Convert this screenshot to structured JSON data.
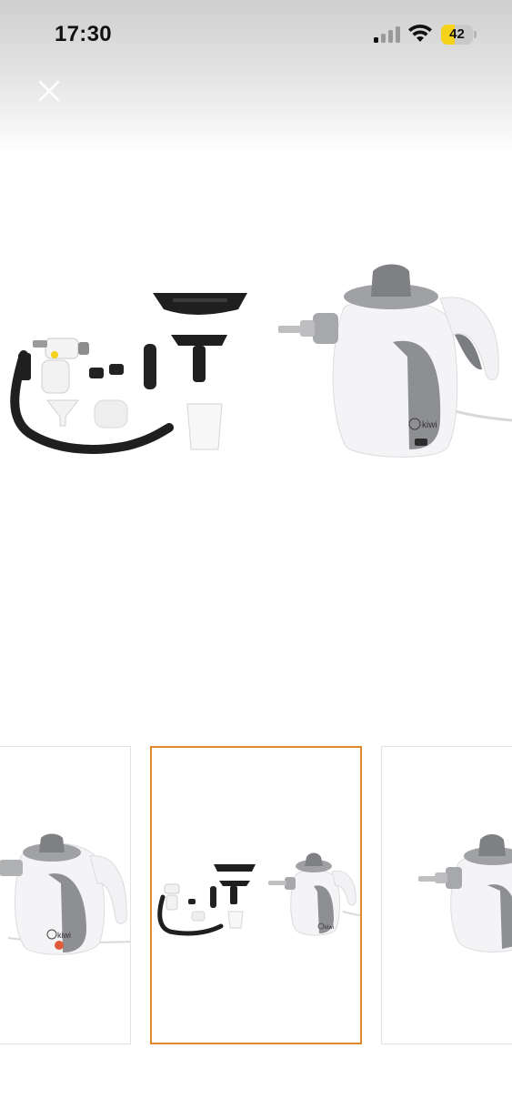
{
  "status_bar": {
    "time": "17:30",
    "battery_level": "42",
    "battery_fraction": 0.42,
    "signal_icon": "cellular-signal-icon",
    "wifi_icon": "wifi-icon"
  },
  "toolbar": {
    "close_icon": "close-icon"
  },
  "main_image": {
    "brand_text": "kiwi",
    "description": "steam-cleaner-with-accessories"
  },
  "thumbnails": [
    {
      "label": "steam-cleaner-front",
      "selected": false,
      "brand_text": "kiwi"
    },
    {
      "label": "steam-cleaner-with-accessories",
      "selected": true,
      "brand_text": "kiwi"
    },
    {
      "label": "steam-cleaner-side",
      "selected": false,
      "brand_text": ""
    }
  ],
  "colors": {
    "selected_border": "#e0892e",
    "battery_fill": "#f5d31a"
  }
}
